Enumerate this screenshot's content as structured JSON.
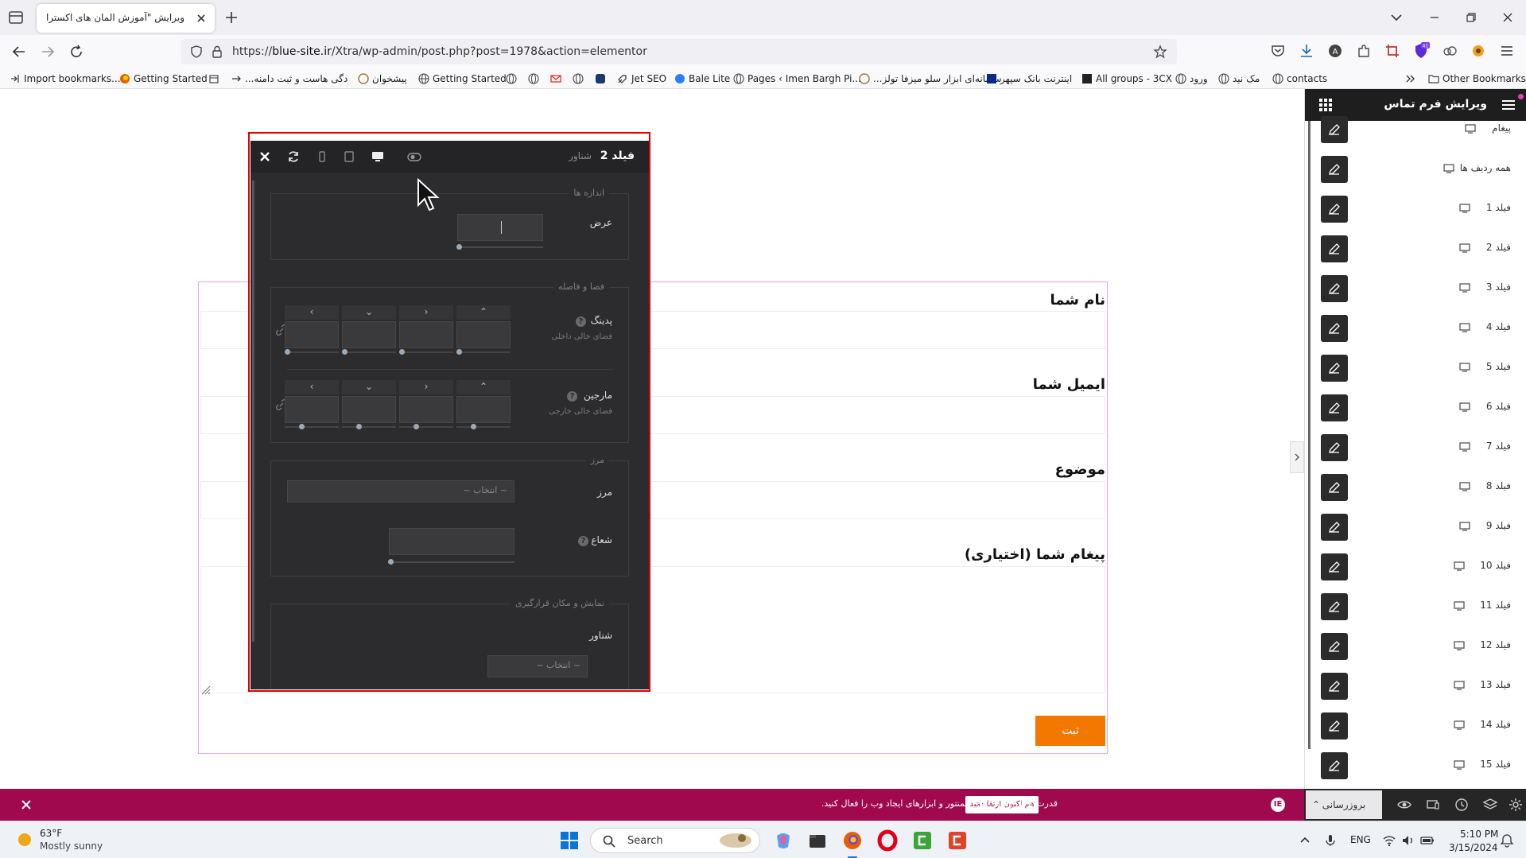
{
  "browser": {
    "tab_title": "ویرایش \"آموزش المان های اکسترا – ما",
    "url_prefix": "https://",
    "url_host": "blue-site.ir",
    "url_path": "/Xtra/wp-admin/post.php?post=1978&action=elementor",
    "extension_badge": "41",
    "bookmarks": [
      "Import bookmarks...",
      "Getting Started",
      "...دگی هاست و ثبت دامنه",
      "پیشخوان",
      "Getting Started",
      "Jet SEO",
      "Bale Lite",
      "Pages ‹ Imen Bargh Pi...",
      "...سامانه‌ای ابزار سلو میزفا تولز",
      "اینترنت بانک سپهر",
      "All groups - 3CX",
      "ورود",
      "مک نید",
      "contacts"
    ],
    "other_bookmarks": "Other Bookmarks"
  },
  "form": {
    "fields": [
      "نام شما",
      "ایمیل شما",
      "موضوع",
      "پیغام شما (اختیاری)"
    ],
    "submit_label": "ثبت"
  },
  "panel": {
    "title": "فیلد 2",
    "subtitle": "شناور",
    "sizes_title": "اندازه ها",
    "width_label": "عرض",
    "spacing_title": "فضا و فاصله",
    "padding_label": "پدینگ",
    "padding_sub": "فضای خالی داخلی",
    "margin_label": "مارجین",
    "margin_sub": "فضای خالی خارجی",
    "border_title": "مرز",
    "border_label": "مرز",
    "border_select": "~ انتخاب ~",
    "radius_label": "شعاع",
    "display_title": "نمایش و مکان قرارگیری",
    "float_label": "شناور",
    "float_select": "~ انتخاب ~",
    "help_mark": "?"
  },
  "sidebar": {
    "title": "ویرایش فرم تماس",
    "items": [
      "پیغام",
      "همه ردیف ها",
      "فیلد 1",
      "فیلد 2",
      "فیلد 3",
      "فیلد 4",
      "فیلد 5",
      "فیلد 6",
      "فیلد 7",
      "فیلد 8",
      "فیلد 9",
      "فیلد 10",
      "فیلد 11",
      "فیلد 12",
      "فیلد 13",
      "فیلد 14",
      "فیلد 15"
    ]
  },
  "promo": {
    "badge": "IE",
    "text": "قدرت کامل ویژگی های المنتور و ابزارهای ایجاد وب را فعال کنید.",
    "cta": "هم اکنون ارتقا دهید"
  },
  "editor_footer": {
    "update_label": "بروزرسانی"
  },
  "taskbar": {
    "temperature": "63°F",
    "condition": "Mostly sunny",
    "search_placeholder": "Search",
    "language": "ENG",
    "time": "5:10 PM",
    "date": "3/15/2024"
  },
  "colors": {
    "submit": "#f27800",
    "panel_bg": "#2c2c2e",
    "panel_outline": "#e30000",
    "promo_bg": "#a0094e",
    "form_outline": "#e6a6e6"
  }
}
